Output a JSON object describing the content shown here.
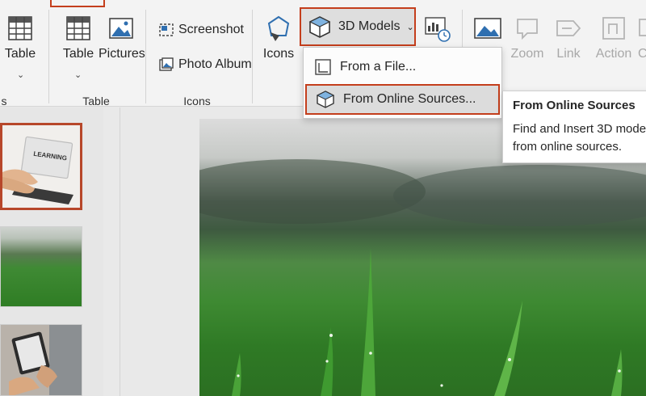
{
  "ribbon": {
    "buttons": {
      "table_left": "Table",
      "table": "Table",
      "pictures": "Pictures",
      "screenshot": "Screenshot",
      "photo_album": "Photo Album",
      "icons": "Icons",
      "models_3d": "3D Models",
      "zoom": "Zoom",
      "link": "Link",
      "action": "Action",
      "comment_partial": "C"
    },
    "groups": {
      "edge_label": "s",
      "tables": "Table",
      "images": "Icons"
    }
  },
  "dropdown": {
    "items": [
      {
        "label": "From a File...",
        "icon": "file-3d-icon"
      },
      {
        "label": "From Online Sources...",
        "icon": "cube-icon",
        "highlighted": true
      }
    ]
  },
  "tooltip": {
    "title": "From Online Sources",
    "description_line1": "Find and Insert 3D mode",
    "description_line2": "from online sources."
  },
  "slides": {
    "thumb1_text": "LEARNING"
  },
  "colors": {
    "accent": "#c43e1c",
    "selection": "#b7472a"
  }
}
